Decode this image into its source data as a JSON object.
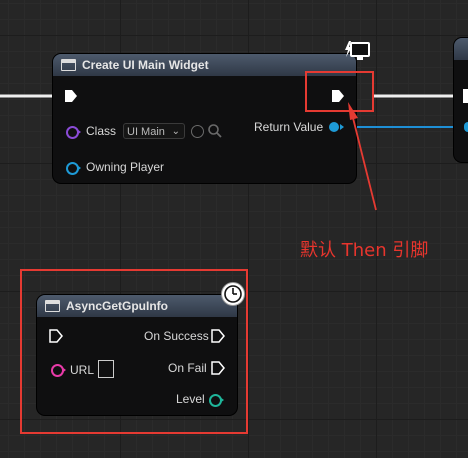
{
  "create_node": {
    "title": "Create UI Main Widget",
    "class_label": "Class",
    "class_value": "UI Main",
    "owning_player_label": "Owning Player",
    "return_value_label": "Return Value"
  },
  "async_node": {
    "title": "AsyncGetGpuInfo",
    "url_label": "URL",
    "on_success_label": "On Success",
    "on_fail_label": "On Fail",
    "level_label": "Level"
  },
  "annotation": {
    "text": "默认 Then 引脚",
    "color": "#e8352d"
  },
  "colors": {
    "object_pin": "#1e9ad6",
    "class_pin": "#8a4bd6",
    "string_pin": "#e83aa8",
    "byte_pin": "#1fb59a"
  },
  "icons": [
    "monitor-icon",
    "clock-icon",
    "function-icon",
    "exec-pin",
    "search-icon",
    "browse-icon"
  ]
}
